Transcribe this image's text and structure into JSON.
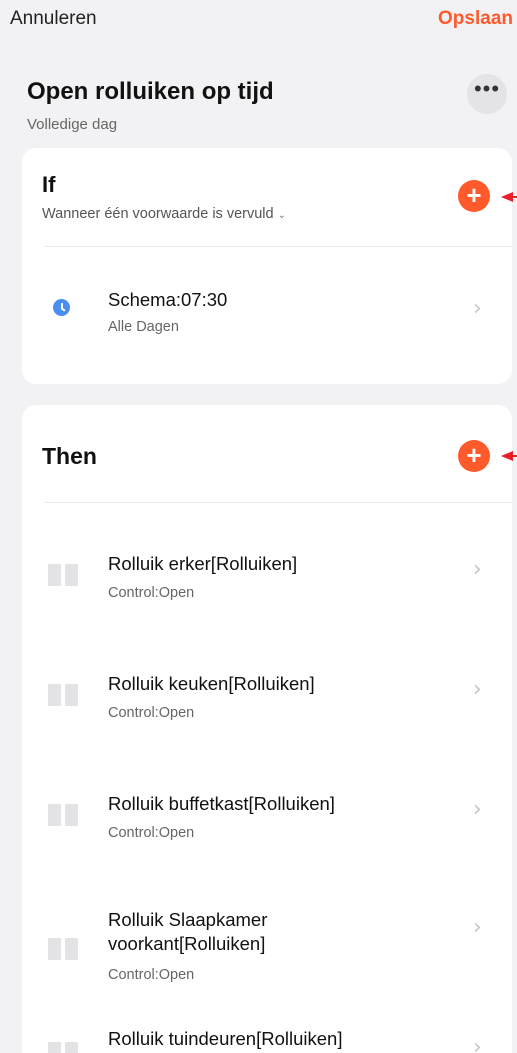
{
  "header": {
    "cancel_label": "Annuleren",
    "save_label": "Opslaan"
  },
  "scene": {
    "title": "Open rolluiken op tijd",
    "subtitle": "Volledige dag",
    "more_label": "•••"
  },
  "if_section": {
    "title": "If",
    "condition_mode": "Wanneer één voorwaarde is vervuld",
    "conditions": [
      {
        "title": "Schema:07:30",
        "subtitle": "Alle Dagen",
        "icon": "clock-icon"
      }
    ]
  },
  "then_section": {
    "title": "Then",
    "actions": [
      {
        "title": "Rolluik erker[Rolluiken]",
        "subtitle": "Control:Open"
      },
      {
        "title": "Rolluik keuken[Rolluiken]",
        "subtitle": "Control:Open"
      },
      {
        "title": "Rolluik buffetkast[Rolluiken]",
        "subtitle": "Control:Open"
      },
      {
        "title": "Rolluik Slaapkamer voorkant[Rolluiken]",
        "subtitle": "Control:Open"
      },
      {
        "title": "Rolluik tuindeuren[Rolluiken]",
        "subtitle": ""
      }
    ]
  },
  "colors": {
    "accent": "#ff5a2b",
    "clock": "#4a8ff0",
    "annotation_arrow": "#e8202a"
  },
  "icons": {
    "add": "+",
    "chevron": "›",
    "dropdown": "⌄"
  }
}
